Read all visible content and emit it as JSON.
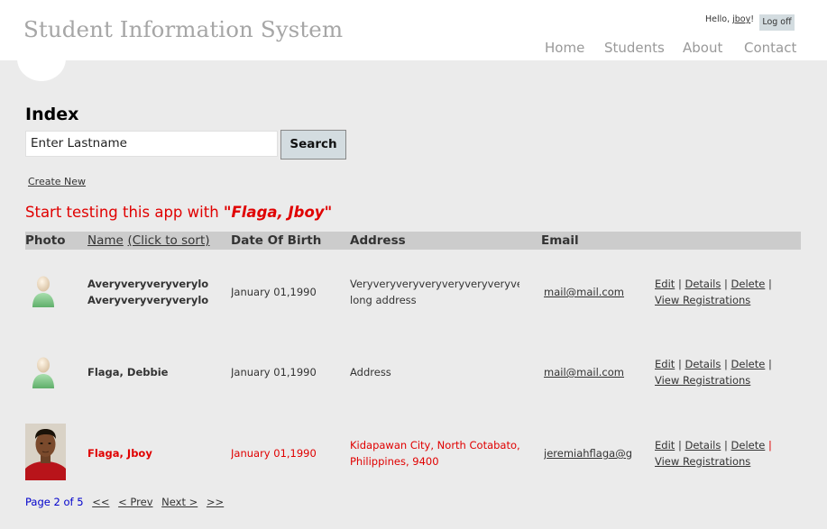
{
  "header": {
    "title": "Student Information System",
    "greeting_prefix": "Hello, ",
    "username": "jboy",
    "greeting_suffix": "!",
    "logoff_label": "Log off",
    "nav": [
      "Home",
      "Students",
      "About",
      "Contact"
    ]
  },
  "page": {
    "heading": "Index",
    "search_placeholder": "Enter Lastname",
    "search_label": "Search",
    "create_new": "Create New",
    "hint_prefix": "Start testing this app with ",
    "hint_highlight": "\"Flaga, Jboy\""
  },
  "table": {
    "headers": {
      "photo": "Photo",
      "name": "Name",
      "name_sort": "(Click to sort)",
      "dob": "Date Of Birth",
      "address": "Address",
      "email": "Email"
    },
    "actions": {
      "edit": "Edit",
      "details": "Details",
      "delete": "Delete",
      "sep": "|",
      "registrations": "View Registrations"
    },
    "rows": [
      {
        "photo": "default-avatar-icon",
        "name_line1": "Averyveryveryverylongl",
        "name_line2": "Averyveryveryverylongf",
        "dob": "January 01,1990",
        "address_line1": "Veryveryveryveryveryveryveryve",
        "address_line2": "long address",
        "email": "mail@mail.com"
      },
      {
        "photo": "default-avatar-icon",
        "name_line1": "Flaga, Debbie",
        "dob": "January 01,1990",
        "address_line1": "Address",
        "email": "mail@mail.com"
      },
      {
        "photo": "student-photo",
        "name_line1": "Flaga, Jboy",
        "dob": "January 01,1990",
        "address_line1": "Kidapawan City, North Cotabato,",
        "address_line2": "Philippines, 9400",
        "email": "jeremiahflaga@gn",
        "highlight": true
      }
    ]
  },
  "pager": {
    "label": "Page 2 of 5",
    "first": "<<",
    "prev": "< Prev",
    "next": "Next >",
    "last": ">>"
  },
  "colors": {
    "highlight": "#e00000",
    "sort_link": "#006400",
    "pager": "#0000cc",
    "header_band": "#cccccc",
    "background": "#ebebeb"
  }
}
